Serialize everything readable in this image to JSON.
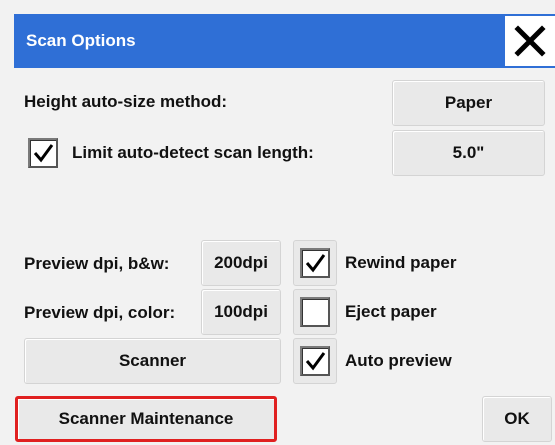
{
  "dialog": {
    "title": "Scan Options",
    "close_icon": "close-icon"
  },
  "height_autosize": {
    "label": "Height auto-size method:",
    "value": "Paper"
  },
  "limit_autodetect": {
    "label": "Limit auto-detect scan length:",
    "checked": true,
    "value": "5.0\""
  },
  "preview_bw": {
    "label": "Preview dpi, b&w:",
    "value": "200dpi"
  },
  "preview_color": {
    "label": "Preview dpi, color:",
    "value": "100dpi"
  },
  "rewind_paper": {
    "label": "Rewind paper",
    "checked": true
  },
  "eject_paper": {
    "label": "Eject paper",
    "checked": false
  },
  "auto_preview": {
    "label": "Auto preview",
    "checked": true
  },
  "buttons": {
    "scanner": "Scanner",
    "scanner_maintenance": "Scanner Maintenance",
    "ok": "OK"
  },
  "colors": {
    "titlebar": "#2f6fd6",
    "highlight_border": "#e02020"
  }
}
